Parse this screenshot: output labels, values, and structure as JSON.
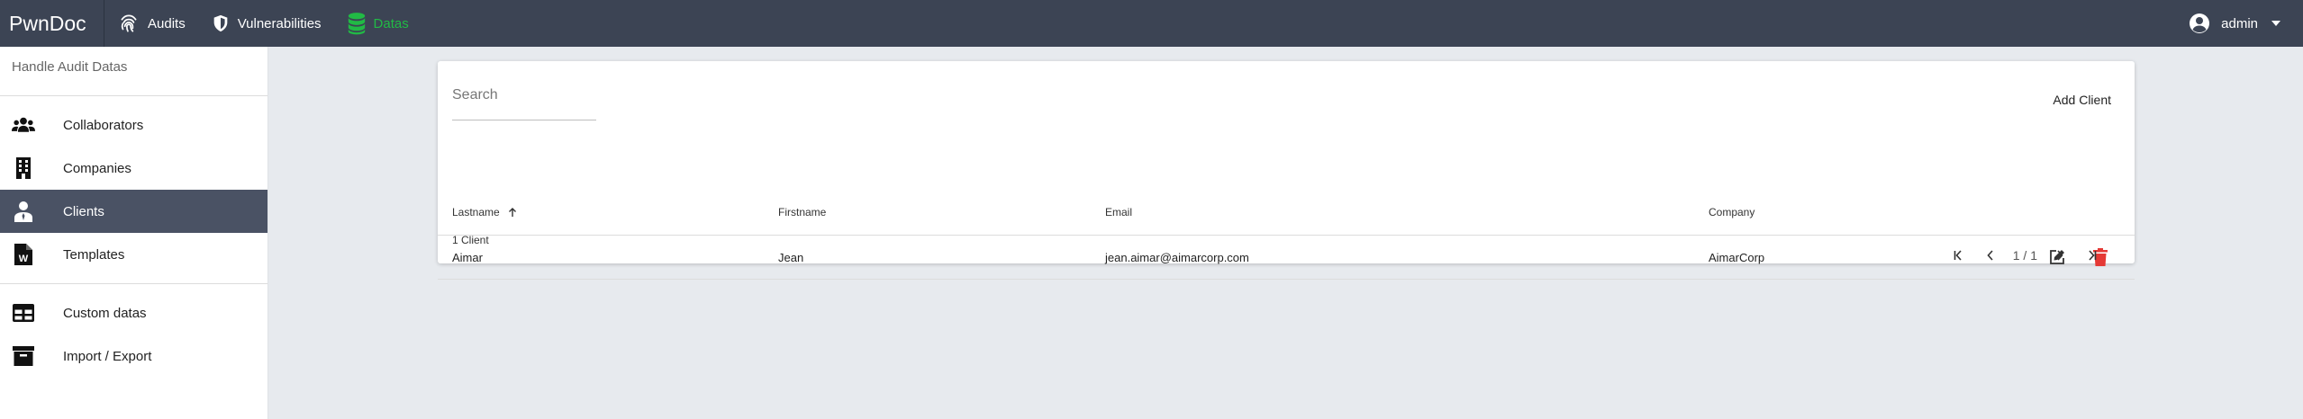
{
  "topbar": {
    "brand": "PwnDoc",
    "nav": [
      {
        "label": "Audits",
        "icon": "fingerprint-icon"
      },
      {
        "label": "Vulnerabilities",
        "icon": "shield-icon"
      },
      {
        "label": "Datas",
        "icon": "database-icon",
        "active": true
      }
    ],
    "user": {
      "name": "admin",
      "icon": "account-circle-icon"
    }
  },
  "colors": {
    "topbar_bg": "#3c4454",
    "active_nav": "#21ba45",
    "sidebar_active_bg": "#4a5264",
    "delete_icon": "#e53935",
    "background": "#e7eaee"
  },
  "sidebar": {
    "header": "Handle Audit Datas",
    "items": [
      {
        "label": "Collaborators",
        "icon": "users-icon"
      },
      {
        "label": "Companies",
        "icon": "building-icon"
      },
      {
        "label": "Clients",
        "icon": "client-icon",
        "active": true
      },
      {
        "label": "Templates",
        "icon": "word-file-icon"
      },
      {
        "label": "Custom datas",
        "icon": "table-icon"
      },
      {
        "label": "Import / Export",
        "icon": "archive-icon"
      }
    ]
  },
  "clients": {
    "search_placeholder": "Search",
    "add_button": "Add Client",
    "columns": [
      "Lastname",
      "Firstname",
      "Email",
      "Company"
    ],
    "sort_column": "Lastname",
    "rows": [
      {
        "lastname": "Aimar",
        "firstname": "Jean",
        "email": "jean.aimar@aimarcorp.com",
        "company": "AimarCorp"
      }
    ],
    "count_label": "1 Client",
    "pagination": "1 / 1"
  }
}
